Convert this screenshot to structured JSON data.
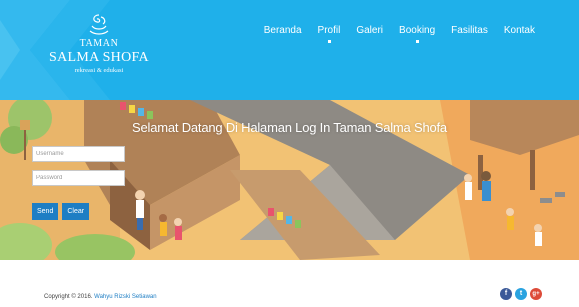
{
  "brand": {
    "line1": "TAMAN",
    "line2": "SALMA SHOFA",
    "tagline": "rekreasi & edukasi"
  },
  "nav": {
    "items": [
      "Beranda",
      "Profil",
      "Galeri",
      "Booking",
      "Fasilitas",
      "Kontak"
    ]
  },
  "hero": {
    "title": "Selamat Datang Di Halaman Log In Taman Salma Shofa"
  },
  "login": {
    "username_placeholder": "Username",
    "password_placeholder": "Password",
    "send_label": "Send",
    "clear_label": "Clear"
  },
  "footer": {
    "copyright": "Copyright © 2016.",
    "author": "Wahyu Rizski Setiawan",
    "social": [
      {
        "icon": "facebook-icon",
        "glyph": "f",
        "color": "#3b5998"
      },
      {
        "icon": "twitter-icon",
        "glyph": "t",
        "color": "#2aa3e0"
      },
      {
        "icon": "google-plus-icon",
        "glyph": "g+",
        "color": "#dd4b39"
      }
    ]
  },
  "colors": {
    "header": "#1fb0ea",
    "button": "#1e7ec4",
    "link": "#1e7ec4"
  }
}
